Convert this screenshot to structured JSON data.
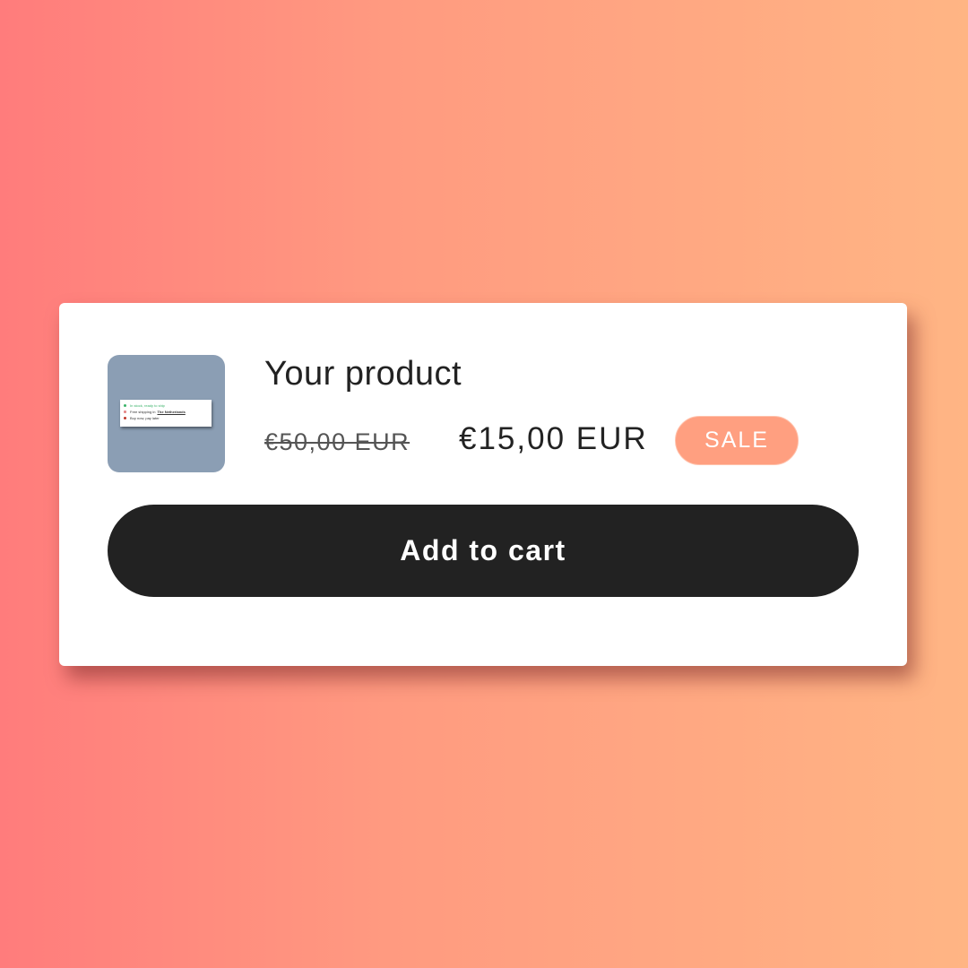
{
  "product": {
    "title": "Your product",
    "original_price": "€50,00 EUR",
    "sale_price": "€15,00 EUR",
    "badge_label": "SALE",
    "add_to_cart_label": "Add to cart",
    "thumbnail": {
      "rows": [
        {
          "icon": "green-dot-icon",
          "text": "In stock, ready to ship"
        },
        {
          "icon": "truck-icon",
          "text": "Free shipping in",
          "link": "The Netherlands"
        },
        {
          "icon": "red-dot-icon",
          "text": "Buy now, pay later"
        }
      ]
    }
  },
  "colors": {
    "background_start": "#ff7c7c",
    "background_end": "#ffb584",
    "badge": "#ff9f80",
    "button": "#222222",
    "thumbnail_bg": "#8b9eb4"
  }
}
